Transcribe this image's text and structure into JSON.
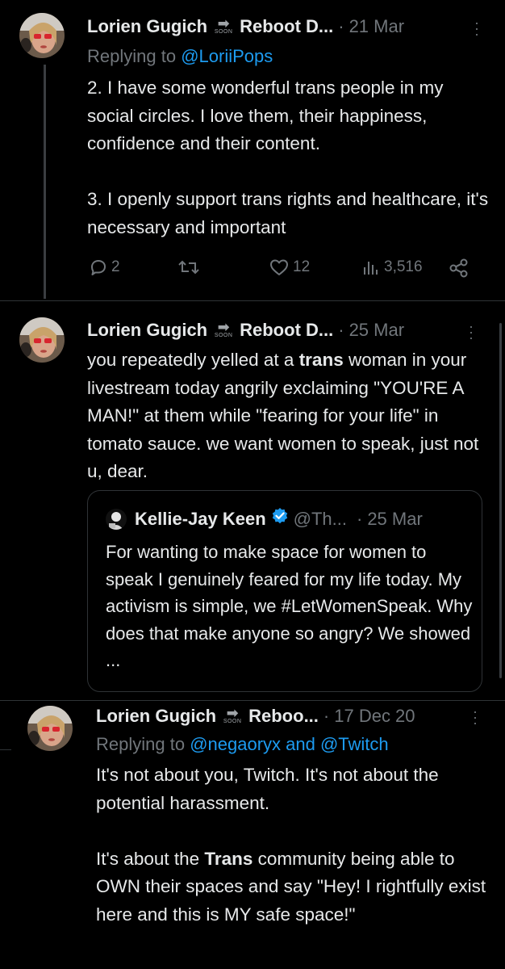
{
  "tweets": [
    {
      "author_name": "Lorien Gugich",
      "badge_text": "SOON",
      "author_suffix": "Reboot D...",
      "separator": "·",
      "date": "21 Mar",
      "replying_prefix": "Replying to ",
      "replying_to": "@LoriiPops",
      "body": "2. I have some wonderful trans people in my social circles. I love them, their happiness, confidence and their content.\n\n3. I openly support trans rights and healthcare, it's necessary and important",
      "replies": "2",
      "retweets": "",
      "likes": "12",
      "views": "3,516"
    },
    {
      "author_name": "Lorien Gugich",
      "badge_text": "SOON",
      "author_suffix": "Reboot D...",
      "separator": "·",
      "date": "25 Mar",
      "body_pre": "you repeatedly yelled at a ",
      "body_bold": "trans",
      "body_post": " woman in your livestream today angrily exclaiming \"YOU'RE A MAN!\" at them while \"fearing for your life\" in tomato sauce. we want women to speak, just not u, dear.",
      "quote": {
        "author_name": "Kellie-Jay Keen",
        "handle": "@Th...",
        "separator": "·",
        "date": "25 Mar",
        "body": "For wanting to make space for women to speak I genuinely feared for my life today.  My activism is simple, we #LetWomenSpeak. Why does that make anyone so angry?  We showed ..."
      }
    },
    {
      "author_name": "Lorien Gugich",
      "badge_text": "SOON",
      "author_suffix": "Reboo...",
      "separator": "·",
      "date": "17 Dec 20",
      "replying_prefix": "Replying to ",
      "replying_to": "@negaoryx and @Twitch",
      "body_p1": "It's not about you, Twitch. It's not about the potential harassment.",
      "body_p2_pre": "It's about the ",
      "body_p2_bold": "Trans",
      "body_p2_post": " community being able to OWN their spaces and say \"Hey! I rightfully exist here and this is MY safe space!\""
    }
  ],
  "colors": {
    "background": "#000000",
    "text": "#e7e9ea",
    "muted": "#71767b",
    "link": "#1d9bf0",
    "border": "#2f3336",
    "verified": "#1d9bf0"
  }
}
